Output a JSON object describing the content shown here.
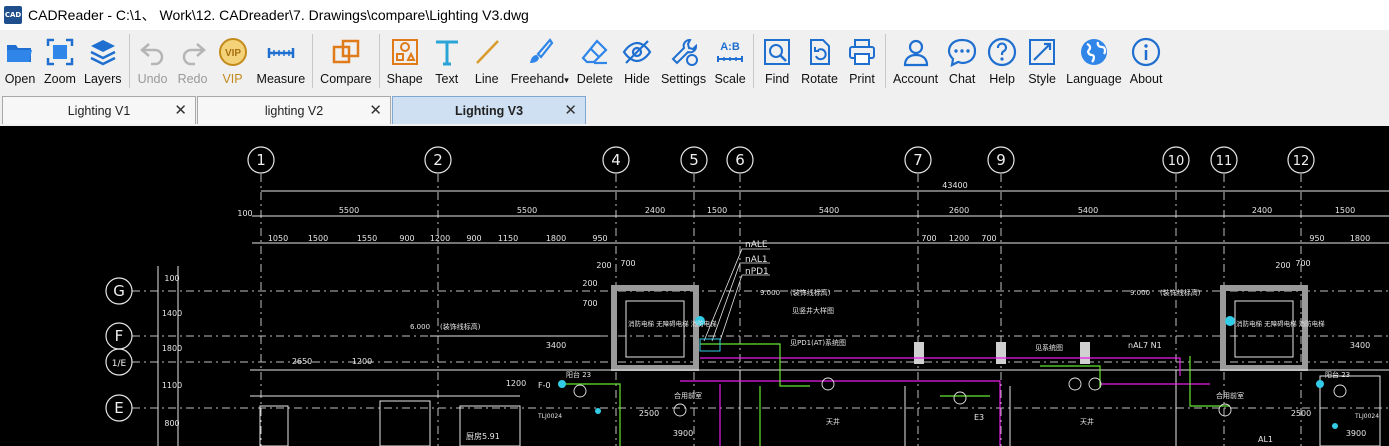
{
  "window": {
    "app_icon_text": "CAD",
    "title": "CADReader - C:\\1、 Work\\12. CADreader\\7. Drawings\\compare\\Lighting V3.dwg"
  },
  "toolbar": {
    "open": "Open",
    "zoom": "Zoom",
    "layers": "Layers",
    "undo": "Undo",
    "redo": "Redo",
    "vip": "VIP",
    "measure": "Measure",
    "compare": "Compare",
    "shape": "Shape",
    "text": "Text",
    "line": "Line",
    "freehand": "Freehand",
    "delete": "Delete",
    "hide": "Hide",
    "settings": "Settings",
    "scale": "Scale",
    "find": "Find",
    "rotate": "Rotate",
    "print": "Print",
    "account": "Account",
    "chat": "Chat",
    "help": "Help",
    "style": "Style",
    "language": "Language",
    "about": "About",
    "vip_badge": "VIP",
    "scale_badge": "A:B"
  },
  "tabs": [
    {
      "label": "Lighting V1",
      "close": "✕"
    },
    {
      "label": "lighting V2",
      "close": "✕"
    },
    {
      "label": "Lighting V3",
      "close": "✕",
      "active": true
    }
  ],
  "drawing": {
    "grid_top": [
      "1",
      "2",
      "4",
      "5",
      "6",
      "7",
      "9",
      "10",
      "11",
      "12"
    ],
    "grid_left": [
      "G",
      "F",
      "1/E",
      "E"
    ],
    "dim_overall": "43400",
    "dim_row1": [
      "100",
      "5500",
      "5500",
      "2400",
      "1500",
      "5400",
      "2600",
      "5400",
      "2400",
      "1500"
    ],
    "dim_row2": [
      "1050",
      "1500",
      "1550",
      "900",
      "1200",
      "900",
      "1150",
      "1800",
      "950",
      "700",
      "1200",
      "700",
      "950",
      "1800"
    ],
    "dim_misc": [
      "200",
      "700",
      "200",
      "700",
      "200",
      "700",
      "3400",
      "3400",
      "2650",
      "1200",
      "1200",
      "2500",
      "2500",
      "3900",
      "3900"
    ],
    "dim_vertical": [
      "100",
      "1400",
      "1800",
      "1100",
      "800"
    ],
    "levels": [
      "9.000",
      "9.000",
      "6.000"
    ],
    "labels": {
      "nale": "nALE",
      "nal1": "nAL1",
      "npd1": "nPD1",
      "cable_tray": "(装饰线标高)",
      "shaft_detail": "见竖井大样图",
      "pdt_detail": "见PD1(AT)系统图",
      "system_diagram": "见系统图",
      "al7n1": "nAL7 N1",
      "elevator_l": "消防电梯 无障碍电梯 消防电梯",
      "elevator_r": "消防电梯 无障碍电梯 消防电梯",
      "lobby_l": "合用前室",
      "lobby_r": "合用前室",
      "patio_l": "天井",
      "patio_r": "天井",
      "kitchen": "厨房5.91",
      "room_l": "阳台 23",
      "room_r": "阳台 23",
      "panel": "TLJ0024",
      "al1": "AL1",
      "e3": "E3",
      "f0": "F-0"
    }
  }
}
